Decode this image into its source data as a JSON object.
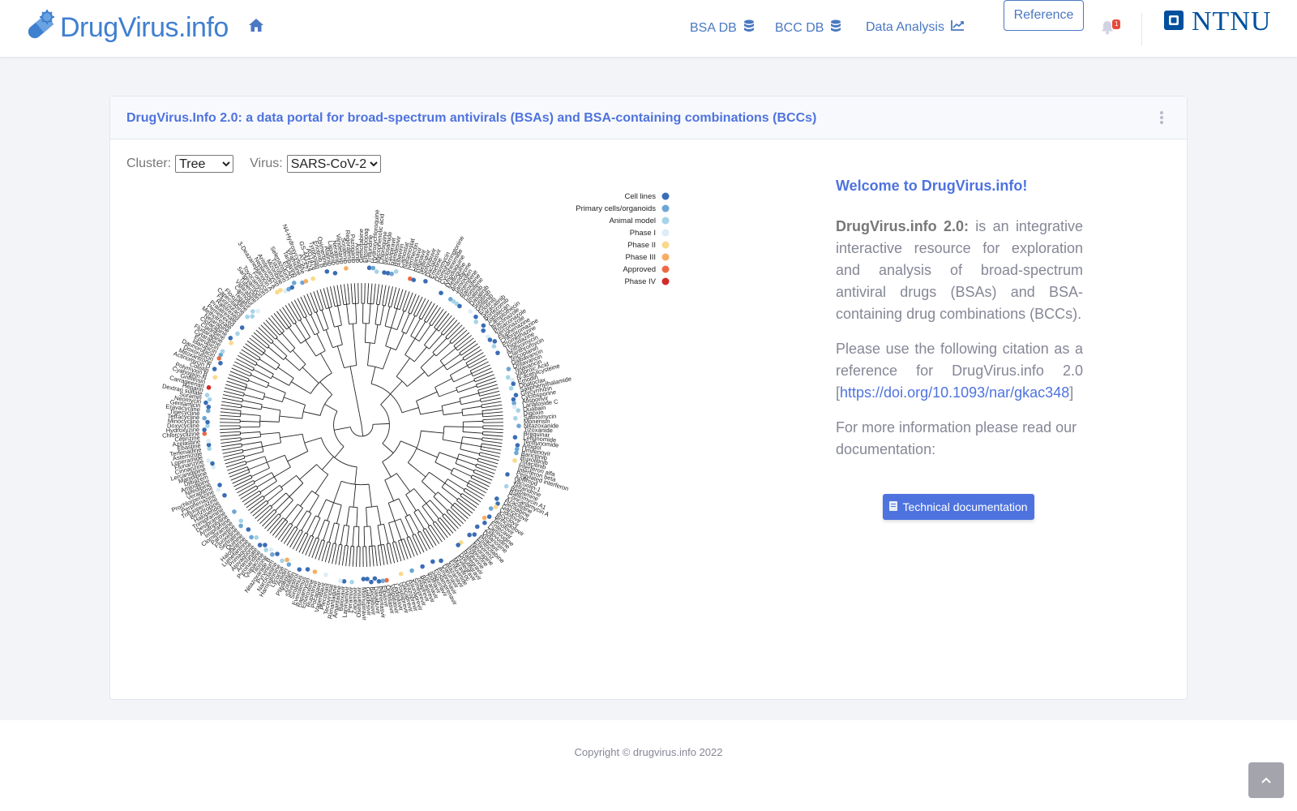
{
  "brand": {
    "name": "DrugVirus.info"
  },
  "nav": {
    "bsa_db": "BSA DB",
    "bcc_db": "BCC DB",
    "data_analysis": "Data Analysis",
    "reference": "Reference",
    "notification_count": "1",
    "partner_logo": "NTNU"
  },
  "card": {
    "title": "DrugVirus.Info 2.0: a data portal for broad-spectrum antivirals (BSAs) and BSA-containing combinations (BCCs)",
    "cluster_label": "Cluster:",
    "cluster_value": "Tree",
    "virus_label": "Virus:",
    "virus_value": "SARS-CoV-2"
  },
  "legend": [
    {
      "label": "Cell lines",
      "color": "#3a6db5"
    },
    {
      "label": "Primary cells/organoids",
      "color": "#6ea6d4"
    },
    {
      "label": "Animal model",
      "color": "#a6d3e8"
    },
    {
      "label": "Phase I",
      "color": "#dcedf6"
    },
    {
      "label": "Phase II",
      "color": "#fbd98a"
    },
    {
      "label": "Phase III",
      "color": "#f7ae62"
    },
    {
      "label": "Approved",
      "color": "#ec6b45"
    },
    {
      "label": "Phase IV",
      "color": "#d42a2a"
    }
  ],
  "drugs": [
    "Gemcitabine",
    "Eltrombopag",
    "Trifluridine",
    "Hydroxychloroquine",
    "Mycophenolic acid",
    "Chloroquine",
    "Niclosamide",
    "Favipiravir",
    "Remdesivir",
    "Ribavirin",
    "Camostat",
    "Nafamostat",
    "Ivermectin",
    "Lopinavir",
    "Ritonavir",
    "Nelfinavir",
    "Sofosbuvir",
    "Daclatasvir",
    "Emetine",
    "Anisomycin",
    "Homoharringtonine",
    "Cycloheximide",
    "Amodiaquine",
    "Mefloquine",
    "Amiodarone",
    "Tamoxifen",
    "Toremifene",
    "Raloxifene",
    "Clomifene",
    "Imatinib",
    "Dasatinib",
    "Sunitinib",
    "Gefitinib",
    "Erlotinib",
    "Saracatinib",
    "Bortezomib",
    "Topotecan",
    "Camptothecin",
    "Itraconazole",
    "Posaconazole",
    "Terconazole",
    "Fluphenazine",
    "Chlorpromazine",
    "Promethazine",
    "Thioridazine",
    "Azithromycin",
    "Clarithromycin",
    "Teicoplanin",
    "Dalbavancin",
    "Oritavancin",
    "Telavancin",
    "Valproic Acid",
    "N-acetylcysteine",
    "Emodin",
    "Obatoclax",
    "Saliphenylhalamide",
    "Glycyrrhizin",
    "Cyclosporine",
    "Alisporivir",
    "Lanatoside C",
    "Ouabain",
    "Digoxin",
    "Salinomycin",
    "Monensin",
    "Nitazoxanide",
    "Tizoxanide",
    "Brequinar",
    "Leflunomide",
    "Teriflunomide",
    "Arbidol",
    "Umifenovir",
    "Baricitinib",
    "Ruxolitinib",
    "Tofacitinib",
    "Interferon alfa",
    "Interferon beta",
    "Pegylated interferon",
    "Apilimod",
    "Vacuolin-1",
    "Tetrandrine",
    "Berbamine",
    "Bafilomycin A1",
    "Concanamycin A",
    "Azacitidine",
    "Decitabine",
    "Ganciclovir",
    "Cidofovir",
    "Acyclovir",
    "Brincidofovir",
    "Tenofovir",
    "Entecavir",
    "Lamivudine",
    "Zidovudine",
    "Didanosine",
    "Abacavir",
    "Emtricitabine",
    "Efavirenz",
    "Nevirapine",
    "Rilpivirine",
    "Etravirine",
    "Raltegravir",
    "Dolutegravir",
    "Elvitegravir",
    "Maraviroc",
    "Enfuvirtide",
    "Atazanavir",
    "Darunavir",
    "Amprenavir",
    "Fosamprenavir",
    "Saquinavir",
    "Indinavir",
    "Tipranavir",
    "Boceprevir",
    "Telaprevir",
    "Simeprevir",
    "Asunaprevir",
    "Grazoprevir",
    "Glecaprevir",
    "Voxilaprevir",
    "Ledipasvir",
    "Velpatasvir",
    "Ombitasvir",
    "Elbasvir",
    "Pibrentasvir",
    "Dasabuvir",
    "Beclabuvir",
    "Galidesivir",
    "Molnupiravir",
    "Oseltamivir",
    "Zanamivir",
    "Peramivir",
    "Laninamivir",
    "Baloxavir",
    "Amantadine",
    "Rimantadine",
    "Tecovirimat",
    "Pleconaril",
    "Vapendavir",
    "Pocapavir",
    "Rupintrivir",
    "Enviroxime",
    "Rapamycin",
    "Everolimus",
    "Sirolimus",
    "Silvestrol",
    "Zotatifin",
    "Plitidepsin",
    "Aplidin",
    "Lycorine",
    "Harringtonine",
    "Narciclasine",
    "Pyrvinium",
    "Nitazoxanide B",
    "Tilorone",
    "Quinacrine",
    "Pyronaridine",
    "Artesunate",
    "Atovaquone",
    "Primaquine",
    "Lumefantrine",
    "Halofantrine",
    "Quinine",
    "Sertraline",
    "Fluoxetine",
    "Paroxetine",
    "Clomipramine",
    "Imipramine",
    "Amitriptyline",
    "Desipramine",
    "Trimipramine",
    "Haloperidol",
    "Benztropine",
    "Trifluoperazine",
    "Perphenazine",
    "Prochlorperazine",
    "Verapamil",
    "Nifedipine",
    "Amlodipine",
    "Diltiazem",
    "Manidipine",
    "Lercanidipine",
    "Cinnarizine",
    "Flunarizine",
    "Loperamide",
    "Astemizole",
    "Terfenadine",
    "Ebastine",
    "Azelastine",
    "Cetirizine",
    "Chlorcyclizine",
    "Hydroxyzine",
    "Doxycycline",
    "Minocycline",
    "Tetracycline",
    "Tigecycline",
    "Eravacycline",
    "Gentamicin",
    "Neomycin",
    "Suramin",
    "Dextran sulfate",
    "Heparin",
    "Carrageenan",
    "Griffithsin",
    "Cyanovirin-N",
    "Polymyxin B",
    "Colistin",
    "Actinomycin D",
    "Mitoxantrone",
    "Doxorubicin",
    "Daunorubicin",
    "Idarubicin",
    "Epirubicin",
    "Cytarabine",
    "Fludarabine",
    "Cladribine",
    "Clofarabine",
    "Nelarabine",
    "Methotrexate",
    "Pemetrexed",
    "Pralatrexate",
    "Raltitrexed",
    "Fluorouracil",
    "Capecitabine",
    "Floxuridine",
    "Tegafur",
    "Carmofur",
    "Vidarabine",
    "Tubercidin",
    "Sangivamycin",
    "Toyocamycin",
    "Formycin",
    "3-Deazaneplanocin A",
    "Neplanocin A",
    "Aristeromycin",
    "Mizoribine",
    "Tiazofurin",
    "Selenazofurin",
    "EICAR",
    "Taribavirin",
    "Viramidine",
    "N4-Hydroxycytidine",
    "AT-527",
    "GS-441524",
    "AG1478",
    "Tyrphostin",
    "Erlotinib B",
    "Osimertinib",
    "Afatinib",
    "Lapatinib",
    "Neratinib",
    "Vandetanib",
    "Sorafenib",
    "Regorafenib",
    "Pazopanib",
    "Axitinib"
  ]
}
